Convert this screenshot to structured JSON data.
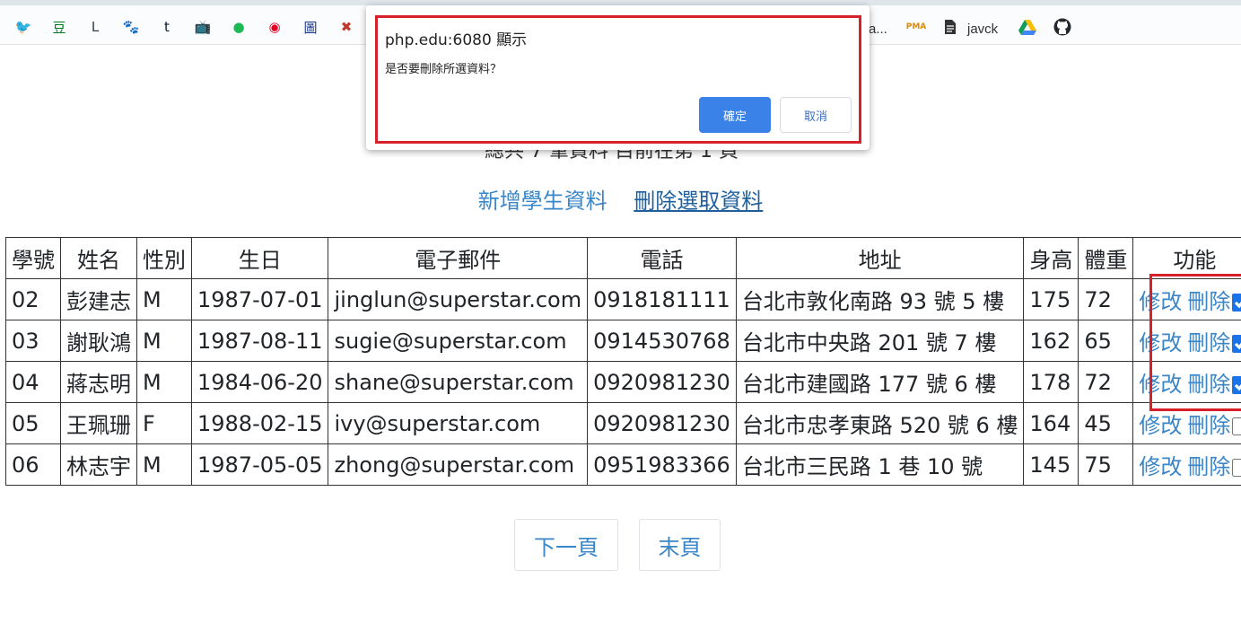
{
  "bookmarks": {
    "icons": [
      {
        "name": "twitter-icon",
        "glyph": "🐦",
        "color": "#1da1f2"
      },
      {
        "name": "douban-icon",
        "glyph": "豆",
        "color": "#007722"
      },
      {
        "name": "letterboxd-icon",
        "glyph": "L",
        "color": "#2c3e50"
      },
      {
        "name": "baidu-icon",
        "glyph": "🐾",
        "color": "#2932e1"
      },
      {
        "name": "tumblr-icon",
        "glyph": "t",
        "color": "#001935"
      },
      {
        "name": "bilibili-icon",
        "glyph": "📺",
        "color": "#00a1d6"
      },
      {
        "name": "spotify-icon",
        "glyph": "●",
        "color": "#1db954"
      },
      {
        "name": "netease-music-icon",
        "glyph": "◉",
        "color": "#e60026"
      },
      {
        "name": "library-icon",
        "glyph": "圖",
        "color": "#1e3a8a"
      },
      {
        "name": "bug-icon",
        "glyph": "✖",
        "color": "#c0392b"
      }
    ],
    "truncated_label": "a...",
    "pma_label": "PMA",
    "doc_label": "javck"
  },
  "page": {
    "subtitle_partial": "總共 7 筆資料 目前在第 1 頁",
    "add_link": "新增學生資料",
    "delete_link": "刪除選取資料"
  },
  "table": {
    "headers": [
      "學號",
      "姓名",
      "性別",
      "生日",
      "電子郵件",
      "電話",
      "地址",
      "身高",
      "體重",
      "功能"
    ],
    "rows": [
      {
        "id": "02",
        "name": "彭建志",
        "gender": "M",
        "birthday": "1987-07-01",
        "email": "jinglun@superstar.com",
        "phone": "0918181111",
        "address": "台北市敦化南路 93 號 5 樓",
        "height": "175",
        "weight": "72",
        "checked": true
      },
      {
        "id": "03",
        "name": "謝耿鴻",
        "gender": "M",
        "birthday": "1987-08-11",
        "email": "sugie@superstar.com",
        "phone": "0914530768",
        "address": "台北市中央路 201 號 7 樓",
        "height": "162",
        "weight": "65",
        "checked": true
      },
      {
        "id": "04",
        "name": "蔣志明",
        "gender": "M",
        "birthday": "1984-06-20",
        "email": "shane@superstar.com",
        "phone": "0920981230",
        "address": "台北市建國路 177 號 6 樓",
        "height": "178",
        "weight": "72",
        "checked": true
      },
      {
        "id": "05",
        "name": "王珮珊",
        "gender": "F",
        "birthday": "1988-02-15",
        "email": "ivy@superstar.com",
        "phone": "0920981230",
        "address": "台北市忠孝東路 520 號 6 樓",
        "height": "164",
        "weight": "45",
        "checked": false
      },
      {
        "id": "06",
        "name": "林志宇",
        "gender": "M",
        "birthday": "1987-05-05",
        "email": "zhong@superstar.com",
        "phone": "0951983366",
        "address": "台北市三民路 1 巷 10 號",
        "height": "145",
        "weight": "75",
        "checked": false
      }
    ],
    "edit_label": "修改",
    "delete_label": "刪除"
  },
  "pagination": {
    "next_label": "下一頁",
    "last_label": "末頁"
  },
  "dialog": {
    "origin": "php.edu:6080 顯示",
    "message": "是否要刪除所選資料？",
    "ok_label": "確定",
    "cancel_label": "取消"
  },
  "colors": {
    "link": "#3a86c8",
    "highlight": "#d8202a",
    "ok_button": "#3b82e8"
  }
}
